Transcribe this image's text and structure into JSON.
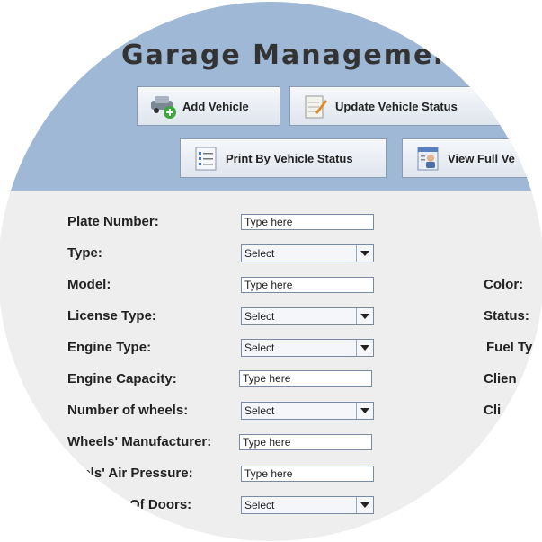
{
  "header": {
    "title": "Garage Management",
    "buttons": [
      {
        "label": "Add Vehicle",
        "icon": "car-add-icon"
      },
      {
        "label": "Update Vehicle Status",
        "icon": "edit-document-icon"
      },
      {
        "label": "Print By Vehicle Status",
        "icon": "list-document-icon"
      },
      {
        "label": "View Full Ve",
        "icon": "user-profile-icon"
      }
    ]
  },
  "form": {
    "fields": [
      {
        "label": "Plate Number:",
        "kind": "input",
        "value": "Type here"
      },
      {
        "label": "Type:",
        "kind": "select",
        "value": "Select"
      },
      {
        "label": "Model:",
        "kind": "input",
        "value": "Type here"
      },
      {
        "label": "License Type:",
        "kind": "select",
        "value": "Select"
      },
      {
        "label": "Engine Type:",
        "kind": "select",
        "value": "Select"
      },
      {
        "label": "Engine Capacity:",
        "kind": "input",
        "value": "Type here"
      },
      {
        "label": "Number of wheels:",
        "kind": "select",
        "value": "Select"
      },
      {
        "label": "Wheels' Manufacturer:",
        "kind": "input",
        "value": "Type here"
      },
      {
        "label": "eels' Air Pressure:",
        "kind": "input",
        "value": "Type here"
      },
      {
        "label": "Of Doors:",
        "kind": "select",
        "value": "Select"
      }
    ],
    "right_labels": [
      "Color:",
      "Status:",
      "Fuel Ty",
      "Clien",
      "Cli"
    ]
  },
  "colors": {
    "header_bg": "#9fb8d6",
    "body_bg": "#eeeeee",
    "border": "#7a8aa5"
  }
}
